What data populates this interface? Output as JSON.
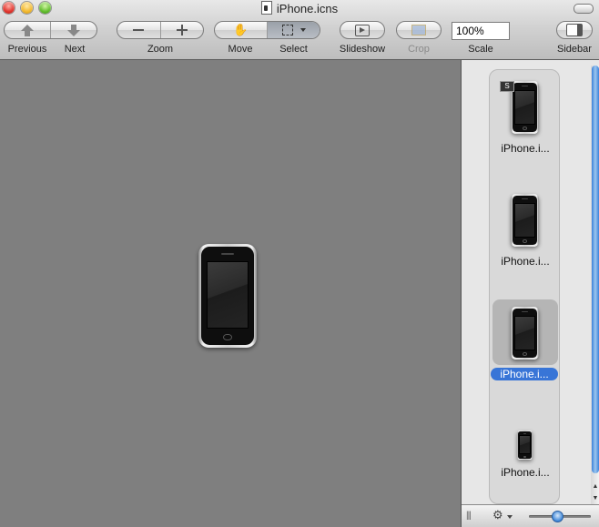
{
  "window": {
    "title": "iPhone.icns"
  },
  "toolbar": {
    "previous_label": "Previous",
    "next_label": "Next",
    "zoom_label": "Zoom",
    "move_label": "Move",
    "select_label": "Select",
    "slideshow_label": "Slideshow",
    "crop_label": "Crop",
    "scale_label": "Scale",
    "scale_value": "100%",
    "sidebar_label": "Sidebar"
  },
  "sidebar": {
    "thumbnails": [
      {
        "label": "iPhone.i...",
        "badge": "S",
        "selected": false
      },
      {
        "label": "iPhone.i...",
        "selected": false
      },
      {
        "label": "iPhone.i...",
        "selected": true
      },
      {
        "label": "iPhone.i...",
        "selected": false
      }
    ],
    "thumbnail_size": 0.45
  },
  "colors": {
    "selection": "#3875d7",
    "canvas_background": "#7f7f7f"
  }
}
